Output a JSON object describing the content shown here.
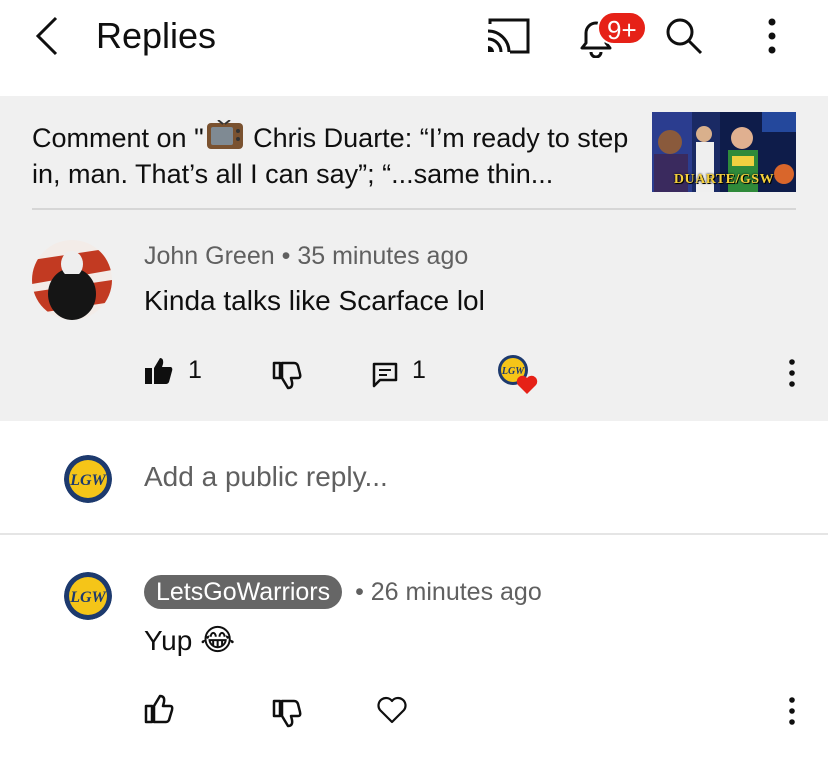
{
  "header": {
    "title": "Replies",
    "notification_badge": "9+",
    "icons": [
      "back-arrow-icon",
      "cast-icon",
      "bell-icon",
      "search-icon",
      "more-vert-icon"
    ]
  },
  "original_comment": {
    "context_prefix": "Comment on \"",
    "context_rest": " Chris Duarte: “I’m ready to step in, man. That’s all I can say”; “...same thin...",
    "thumbnail_caption": "DUARTE/GSW",
    "author": "John Green",
    "separator": "•",
    "time": "35 minutes ago",
    "text": "Kinda talks like Scarface lol",
    "like_count": "1",
    "reply_count": "1",
    "creator_heart_avatar": "LGW"
  },
  "reply_box": {
    "placeholder": "Add a public reply...",
    "avatar": "LGW"
  },
  "reply": {
    "author": "LetsGoWarriors",
    "separator": "•",
    "time": "26 minutes ago",
    "text": "Yup",
    "emoji": "😂",
    "avatar": "LGW"
  },
  "colors": {
    "badge": "#e62117",
    "comment_bg": "#f0f0f0",
    "secondary_text": "#606060",
    "heart": "#e62117",
    "lgw_yellow": "#f5c518",
    "lgw_navy": "#1d3a6e"
  }
}
